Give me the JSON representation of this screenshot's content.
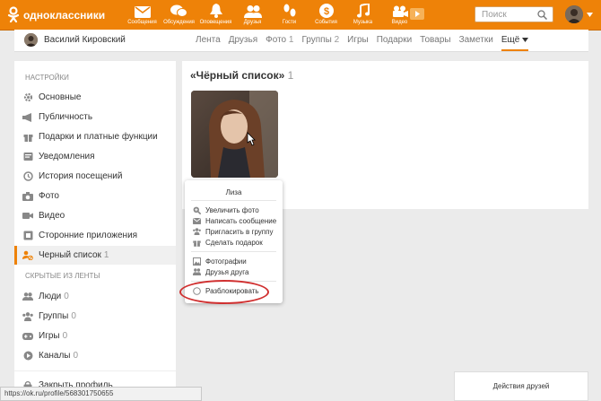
{
  "topbar": {
    "logo_text": "одноклассники",
    "nav": [
      {
        "label": "Сообщения",
        "icon": "envelope-icon"
      },
      {
        "label": "Обсуждения",
        "icon": "chat-bubbles-icon"
      },
      {
        "label": "Оповещения",
        "icon": "bell-icon"
      },
      {
        "label": "Друзья",
        "icon": "people-icon"
      },
      {
        "label": "Гости",
        "icon": "footprints-icon"
      },
      {
        "label": "События",
        "icon": "dollar-event-icon"
      },
      {
        "label": "Музыка",
        "icon": "music-note-icon"
      },
      {
        "label": "Видео",
        "icon": "video-camera-icon"
      }
    ],
    "search_placeholder": "Поиск"
  },
  "subbar": {
    "user_name": "Василий Кировский",
    "tabs": [
      {
        "label": "Лента",
        "count": ""
      },
      {
        "label": "Друзья",
        "count": ""
      },
      {
        "label": "Фото",
        "count": "1"
      },
      {
        "label": "Группы",
        "count": "2"
      },
      {
        "label": "Игры",
        "count": ""
      },
      {
        "label": "Подарки",
        "count": ""
      },
      {
        "label": "Товары",
        "count": ""
      },
      {
        "label": "Заметки",
        "count": ""
      },
      {
        "label": "Ещё",
        "count": ""
      }
    ]
  },
  "sidebar": {
    "settings_header": "НАСТРОЙКИ",
    "settings_items": [
      {
        "label": "Основные",
        "icon": "gear-icon",
        "count": ""
      },
      {
        "label": "Публичность",
        "icon": "megaphone-icon",
        "count": ""
      },
      {
        "label": "Подарки и платные функции",
        "icon": "gift-icon",
        "count": ""
      },
      {
        "label": "Уведомления",
        "icon": "bell-icon",
        "count": ""
      },
      {
        "label": "История посещений",
        "icon": "history-icon",
        "count": ""
      },
      {
        "label": "Фото",
        "icon": "camera-icon",
        "count": ""
      },
      {
        "label": "Видео",
        "icon": "video-icon",
        "count": ""
      },
      {
        "label": "Сторонние приложения",
        "icon": "apps-icon",
        "count": ""
      },
      {
        "label": "Черный список",
        "icon": "blocked-user-icon",
        "count": "1"
      }
    ],
    "hidden_header": "СКРЫТЫЕ ИЗ ЛЕНТЫ",
    "hidden_items": [
      {
        "label": "Люди",
        "icon": "people-icon",
        "count": "0"
      },
      {
        "label": "Группы",
        "icon": "groups-icon",
        "count": "0"
      },
      {
        "label": "Игры",
        "icon": "gamepad-icon",
        "count": "0"
      },
      {
        "label": "Каналы",
        "icon": "channel-icon",
        "count": "0"
      }
    ],
    "close_profile": "Закрыть профиль"
  },
  "main": {
    "title": "«Чёрный список»",
    "count": "1"
  },
  "popup": {
    "name": "Лиза",
    "items": [
      {
        "label": "Увеличить фото",
        "icon": "zoom-icon"
      },
      {
        "label": "Написать сообщение",
        "icon": "envelope-icon"
      },
      {
        "label": "Пригласить в группу",
        "icon": "invite-group-icon"
      },
      {
        "label": "Сделать подарок",
        "icon": "gift-icon"
      }
    ],
    "items2": [
      {
        "label": "Фотографии",
        "icon": "photos-icon"
      },
      {
        "label": "Друзья друга",
        "icon": "friends-icon"
      }
    ],
    "unblock": "Разблокировать"
  },
  "status_url": "https://ok.ru/profile/568301750655",
  "friends_actions": "Действия друзей",
  "colors": {
    "accent": "#ee8208",
    "highlight_ring": "#d03030"
  }
}
